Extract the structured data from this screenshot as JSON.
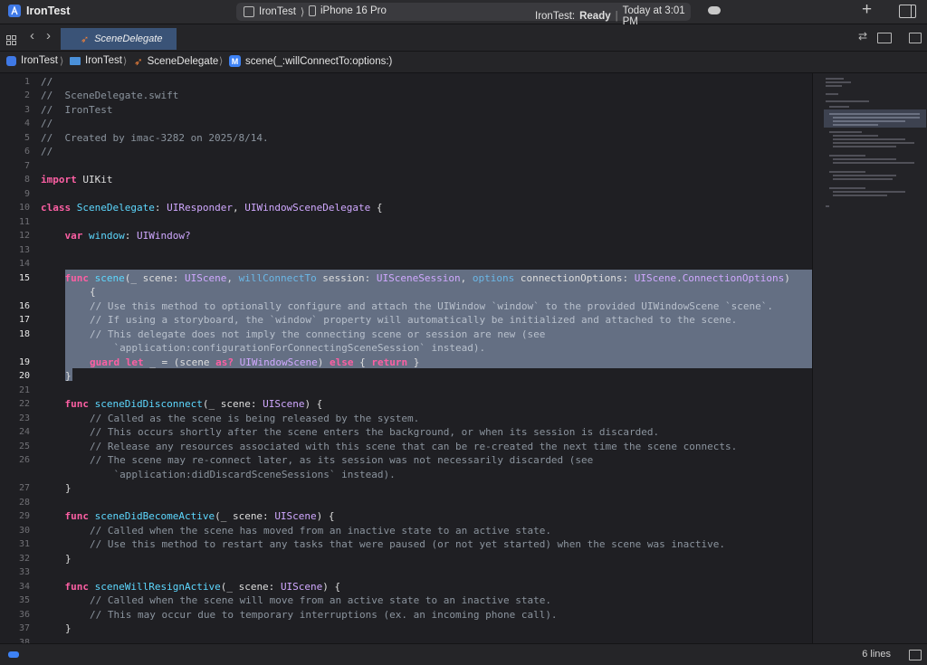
{
  "titlebar": {
    "app_name": "IronTest",
    "scheme_target": "IronTest",
    "device": "iPhone 16 Pro",
    "status_prefix": "IronTest:",
    "status_state": "Ready",
    "status_time": "Today at 3:01 PM",
    "add_label": "+"
  },
  "tabbar": {
    "active_tab": "SceneDelegate"
  },
  "jumpbar": {
    "items": [
      "IronTest",
      "IronTest",
      "SceneDelegate",
      "scene(_:willConnectTo:options:)"
    ],
    "method_badge": "M"
  },
  "editor": {
    "selected_lines": [
      15,
      16,
      17,
      18,
      19,
      20
    ],
    "line_numbers": [
      "1",
      "2",
      "3",
      "4",
      "5",
      "6",
      "7",
      "8",
      "9",
      "10",
      "11",
      "12",
      "13",
      "14",
      "15",
      "16",
      "17",
      "18",
      "19",
      "20",
      "21",
      "22",
      "23",
      "24",
      "25",
      "26",
      "27",
      "28",
      "29",
      "30",
      "31",
      "32",
      "33",
      "34",
      "35",
      "36",
      "37",
      "38"
    ],
    "code": {
      "l1": "//",
      "l2": "//  SceneDelegate.swift",
      "l3": "//  IronTest",
      "l4": "//",
      "l5": "//  Created by imac-3282 on 2025/8/14.",
      "l6": "//",
      "l8_kw": "import",
      "l8_rest": " UIKit",
      "l10_kw": "class",
      "l10_name": "SceneDelegate",
      "l10_colon": ": ",
      "l10_t1": "UIResponder",
      "l10_comma": ", ",
      "l10_t2": "UIWindowSceneDelegate",
      "l10_brace": " {",
      "l12_kw": "var",
      "l12_name": "window",
      "l12_colon": ": ",
      "l12_type": "UIWindow?",
      "l15_kw": "func",
      "l15_fn": "scene",
      "l15_a": "(_ scene: ",
      "l15_t1": "UIScene",
      "l15_b": ", ",
      "l15_p1": "willConnectTo",
      "l15_c": " session: ",
      "l15_t2": "UISceneSession",
      "l15_d": ", ",
      "l15_p2": "options",
      "l15_e": " connectionOptions: ",
      "l15_t3": "UIScene",
      "l15_dot": ".",
      "l15_t4": "ConnectionOptions",
      "l15_f": ")",
      "l15b": "{",
      "l16": "// Use this method to optionally configure and attach the UIWindow `window` to the provided UIWindowScene `scene`.",
      "l17": "// If using a storyboard, the `window` property will automatically be initialized and attached to the scene.",
      "l18": "// This delegate does not imply the connecting scene or session are new (see",
      "l18b": "    `application:configurationForConnectingSceneSession` instead).",
      "l19_kw1": "guard",
      "l19_kw2": "let",
      "l19_a": " _ = (scene ",
      "l19_kw3": "as?",
      "l19_t": "UIWindowScene",
      "l19_b": ") ",
      "l19_kw4": "else",
      "l19_c": " { ",
      "l19_kw5": "return",
      "l19_d": " }",
      "l20": "}",
      "l22_kw": "func",
      "l22_fn": "sceneDidDisconnect",
      "l22_a": "(_ scene: ",
      "l22_t": "UIScene",
      "l22_b": ") {",
      "l23": "// Called as the scene is being released by the system.",
      "l24": "// This occurs shortly after the scene enters the background, or when its session is discarded.",
      "l25": "// Release any resources associated with this scene that can be re-created the next time the scene connects.",
      "l26": "// The scene may re-connect later, as its session was not necessarily discarded (see",
      "l26b": "    `application:didDiscardSceneSessions` instead).",
      "l27": "}",
      "l29_kw": "func",
      "l29_fn": "sceneDidBecomeActive",
      "l29_a": "(_ scene: ",
      "l29_t": "UIScene",
      "l29_b": ") {",
      "l30": "// Called when the scene has moved from an inactive state to an active state.",
      "l31": "// Use this method to restart any tasks that were paused (or not yet started) when the scene was inactive.",
      "l32": "}",
      "l34_kw": "func",
      "l34_fn": "sceneWillResignActive",
      "l34_a": "(_ scene: ",
      "l34_t": "UIScene",
      "l34_b": ") {",
      "l35": "// Called when the scene will move from an active state to an inactive state.",
      "l36": "// This may occur due to temporary interruptions (ex. an incoming phone call).",
      "l37": "}"
    }
  },
  "statusbar": {
    "line_count": "6 lines"
  },
  "colors": {
    "selection": "#646f83",
    "keyword": "#fc5fa3",
    "type": "#d0a8ff",
    "comment": "#8b949e",
    "accent": "#3d82f5"
  }
}
